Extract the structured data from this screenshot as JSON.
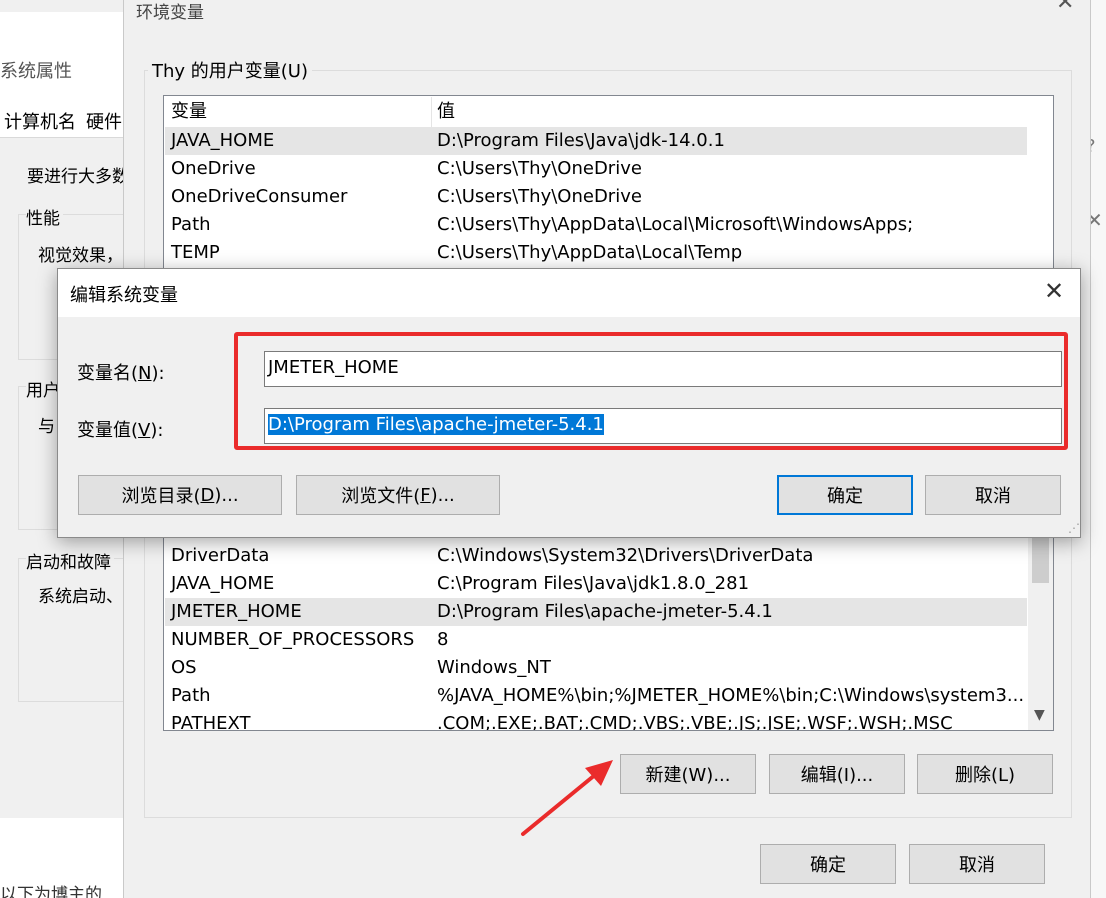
{
  "system_properties": {
    "title": "系统属性",
    "tabs": [
      "计算机名",
      "硬件"
    ],
    "intro_text": "要进行大多数",
    "perf_group": "性能",
    "perf_text": "视觉效果，",
    "user_group": "用户",
    "user_text": "与",
    "startup_group": "启动和故障",
    "startup_text": "系统启动、",
    "bottom_text": "以下为博主的"
  },
  "env_window": {
    "title": "环境变量",
    "user_group_label": "Thy 的用户变量(U)",
    "columns": [
      "变量",
      "值"
    ],
    "user_vars": [
      {
        "name": "JAVA_HOME",
        "value": "D:\\Program Files\\Java\\jdk-14.0.1"
      },
      {
        "name": "OneDrive",
        "value": "C:\\Users\\Thy\\OneDrive"
      },
      {
        "name": "OneDriveConsumer",
        "value": "C:\\Users\\Thy\\OneDrive"
      },
      {
        "name": "Path",
        "value": "C:\\Users\\Thy\\AppData\\Local\\Microsoft\\WindowsApps;"
      },
      {
        "name": "TEMP",
        "value": "C:\\Users\\Thy\\AppData\\Local\\Temp"
      }
    ],
    "system_vars": [
      {
        "name": "DriverData",
        "value": "C:\\Windows\\System32\\Drivers\\DriverData"
      },
      {
        "name": "JAVA_HOME",
        "value": "C:\\Program Files\\Java\\jdk1.8.0_281"
      },
      {
        "name": "JMETER_HOME",
        "value": "D:\\Program Files\\apache-jmeter-5.4.1"
      },
      {
        "name": "NUMBER_OF_PROCESSORS",
        "value": "8"
      },
      {
        "name": "OS",
        "value": "Windows_NT"
      },
      {
        "name": "Path",
        "value": "%JAVA_HOME%\\bin;%JMETER_HOME%\\bin;C:\\Windows\\system3..."
      },
      {
        "name": "PATHEXT",
        "value": ".COM;.EXE;.BAT;.CMD;.VBS;.VBE;.JS;.JSE;.WSF;.WSH;.MSC"
      }
    ],
    "new_button": "新建(W)...",
    "edit_button": "编辑(I)...",
    "delete_button": "删除(L)",
    "ok_button": "确定",
    "cancel_button": "取消"
  },
  "edit_dialog": {
    "title": "编辑系统变量",
    "name_label_pre": "变量名(",
    "name_label_key": "N",
    "name_label_post": "):",
    "value_label_pre": "变量值(",
    "value_label_key": "V",
    "value_label_post": "):",
    "name_value": "JMETER_HOME",
    "value_value": "D:\\Program Files\\apache-jmeter-5.4.1",
    "browse_dir_pre": "浏览目录(",
    "browse_dir_key": "D",
    "browse_dir_post": ")...",
    "browse_file_pre": "浏览文件(",
    "browse_file_key": "F",
    "browse_file_post": ")...",
    "ok_button": "确定",
    "cancel_button": "取消"
  },
  "colors": {
    "highlight_box": "#ea2b2b",
    "arrow": "#ea2b2b",
    "selection": "#0078d7"
  }
}
